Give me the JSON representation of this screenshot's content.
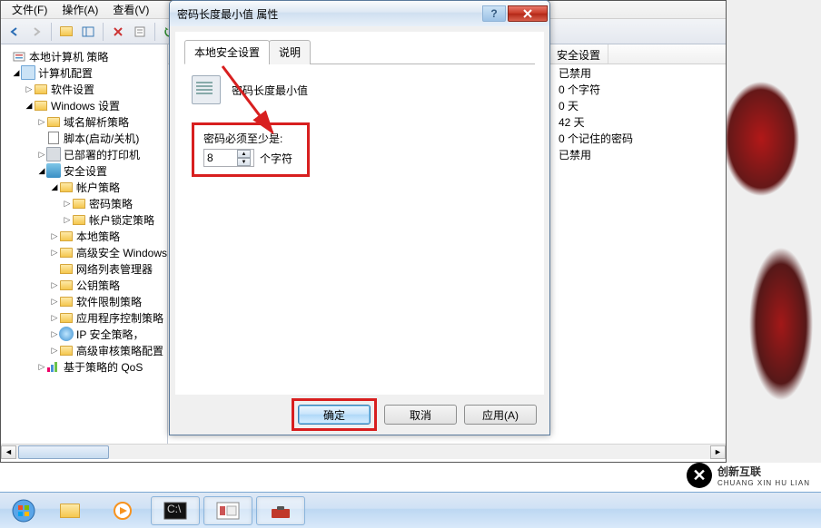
{
  "menubar": {
    "file": "文件(F)",
    "action": "操作(A)",
    "view": "查看(V)"
  },
  "tree": {
    "root": "本地计算机 策略",
    "computer_config": "计算机配置",
    "software_settings": "软件设置",
    "windows_settings": "Windows 设置",
    "name_resolution": "域名解析策略",
    "scripts": "脚本(启动/关机)",
    "deployed_printers": "已部署的打印机",
    "security_settings": "安全设置",
    "account_policies": "帐户策略",
    "password_policy": "密码策略",
    "lockout_policy": "帐户锁定策略",
    "local_policies": "本地策略",
    "advanced_windows": "高级安全 Windows",
    "network_list": "网络列表管理器",
    "public_key": "公钥策略",
    "software_restriction": "软件限制策略",
    "app_control": "应用程序控制策略",
    "ip_security": "IP 安全策略，",
    "advanced_audit": "高级审核策略配置",
    "qos": "基于策略的 QoS"
  },
  "right_pane": {
    "col_header": "安全设置",
    "rows": [
      "已禁用",
      "0 个字符",
      "0 天",
      "42 天",
      "0 个记住的密码",
      "已禁用"
    ]
  },
  "dialog": {
    "title": "密码长度最小值 属性",
    "tab_local": "本地安全设置",
    "tab_explain": "说明",
    "heading": "密码长度最小值",
    "field_label": "密码必须至少是:",
    "value": "8",
    "unit": "个字符",
    "ok": "确定",
    "cancel": "取消",
    "apply": "应用(A)"
  },
  "logo": {
    "text": "创新互联",
    "sub": "CHUANG XIN HU LIAN"
  }
}
